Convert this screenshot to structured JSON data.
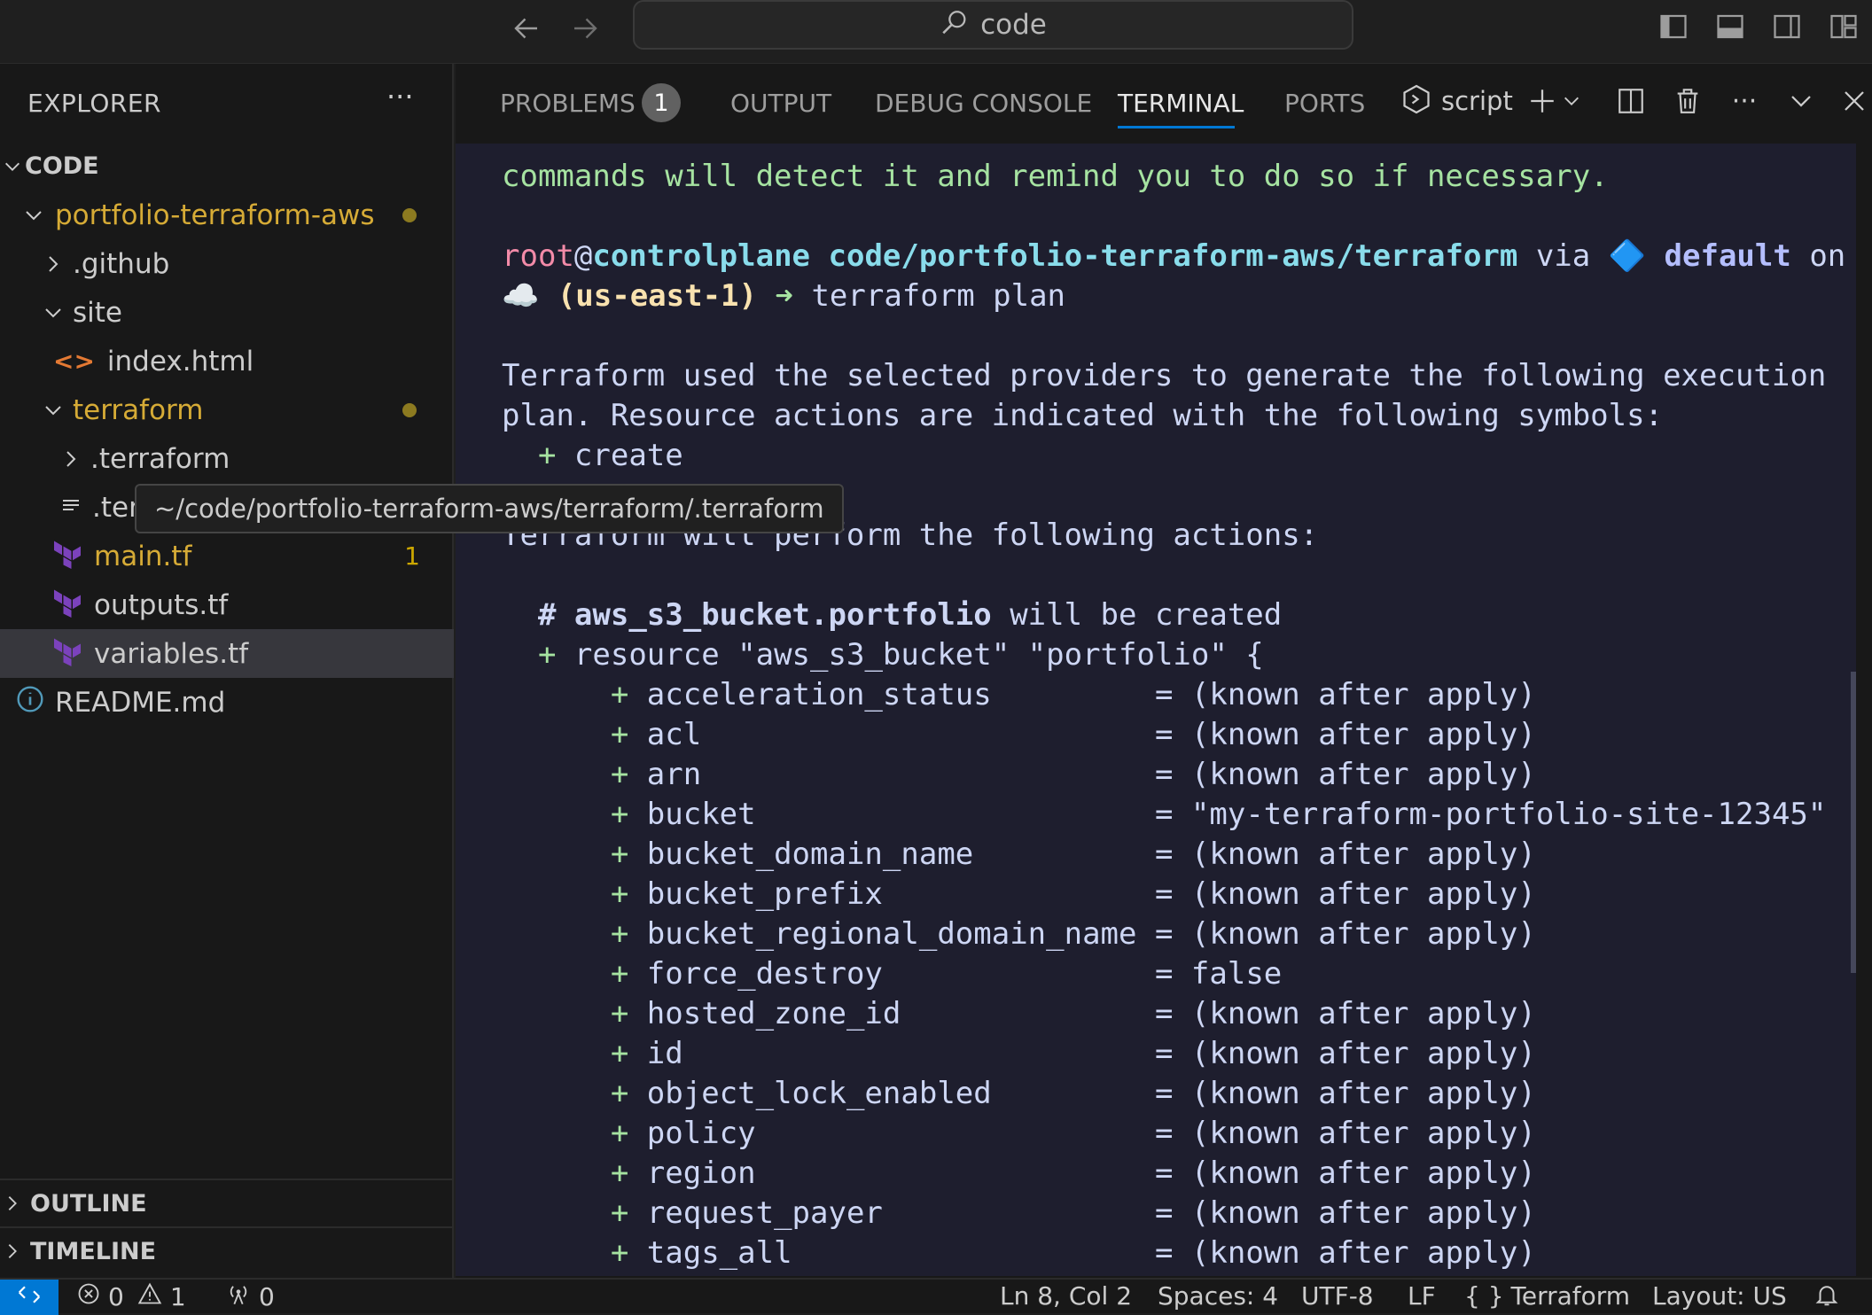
{
  "titlebar": {
    "search_text": "code"
  },
  "sidebar": {
    "title": "EXPLORER",
    "root_label": "CODE",
    "tree": [
      {
        "label": "portfolio-terraform-aws",
        "kind": "folder-open",
        "modified": true
      },
      {
        "label": ".github",
        "kind": "folder-closed"
      },
      {
        "label": "site",
        "kind": "folder-open"
      },
      {
        "label": "index.html",
        "kind": "html"
      },
      {
        "label": "terraform",
        "kind": "folder-open",
        "modified": true
      },
      {
        "label": ".terraform",
        "kind": "folder-closed"
      },
      {
        "label": ".ter",
        "kind": "lines"
      },
      {
        "label": "main.tf",
        "kind": "tf",
        "problems": "1"
      },
      {
        "label": "outputs.tf",
        "kind": "tf"
      },
      {
        "label": "variables.tf",
        "kind": "tf",
        "selected": true
      },
      {
        "label": "README.md",
        "kind": "info"
      }
    ],
    "outline_label": "OUTLINE",
    "timeline_label": "TIMELINE"
  },
  "tooltip": {
    "text": "~/code/portfolio-terraform-aws/terraform/.terraform"
  },
  "panel": {
    "tabs": [
      {
        "label": "PROBLEMS",
        "badge": "1"
      },
      {
        "label": "OUTPUT"
      },
      {
        "label": "DEBUG CONSOLE"
      },
      {
        "label": "TERMINAL",
        "active": true
      },
      {
        "label": "PORTS"
      }
    ],
    "terminal_name": "script"
  },
  "terminal": {
    "line_reminder": "commands will detect it and remind you to do so if necessary.",
    "prompt": {
      "user": "root",
      "at": "@",
      "host": "controlplane",
      "path": "code/portfolio-terraform-aws/terraform",
      "via": " via ",
      "diamond": "🔷",
      "profile": "default",
      "on": " on",
      "cloud": "☁️",
      "region": "(us-east-1)",
      "arrow": "➜",
      "command": "terraform plan"
    },
    "intro_1": "Terraform used the selected providers to generate the following execution",
    "intro_2": "plan. Resource actions are indicated with the following symbols:",
    "create_symbol": "+",
    "create_label": "create",
    "perform_line": "Terraform will perform the following actions:",
    "resource_comment_hash": "#",
    "resource_name": "aws_s3_bucket.portfolio",
    "resource_comment_rest": " will be created",
    "resource_decl": "resource \"aws_s3_bucket\" \"portfolio\" {",
    "attributes": [
      {
        "name": "acceleration_status",
        "value": "(known after apply)"
      },
      {
        "name": "acl",
        "value": "(known after apply)"
      },
      {
        "name": "arn",
        "value": "(known after apply)"
      },
      {
        "name": "bucket",
        "value": "\"my-terraform-portfolio-site-12345\""
      },
      {
        "name": "bucket_domain_name",
        "value": "(known after apply)"
      },
      {
        "name": "bucket_prefix",
        "value": "(known after apply)"
      },
      {
        "name": "bucket_regional_domain_name",
        "value": "(known after apply)"
      },
      {
        "name": "force_destroy",
        "value": "false"
      },
      {
        "name": "hosted_zone_id",
        "value": "(known after apply)"
      },
      {
        "name": "id",
        "value": "(known after apply)"
      },
      {
        "name": "object_lock_enabled",
        "value": "(known after apply)"
      },
      {
        "name": "policy",
        "value": "(known after apply)"
      },
      {
        "name": "region",
        "value": "(known after apply)"
      },
      {
        "name": "request_payer",
        "value": "(known after apply)"
      },
      {
        "name": "tags_all",
        "value": "(known after apply)"
      }
    ]
  },
  "statusbar": {
    "errors": "0",
    "warnings": "1",
    "ports": "0",
    "cursor": "Ln 8, Col 2",
    "spaces": "Spaces: 4",
    "encoding": "UTF-8",
    "eol": "LF",
    "language_braces": "{ }",
    "language": "Terraform",
    "layout": "Layout: US"
  },
  "colors": {
    "accent": "#0078d4",
    "terminal_bg": "#1e1e2e",
    "terminal_green": "#a6e3a1",
    "terminal_red": "#f38ba8",
    "terraform_purple": "#7b42bc",
    "modified_yellow": "#d6ab36"
  }
}
